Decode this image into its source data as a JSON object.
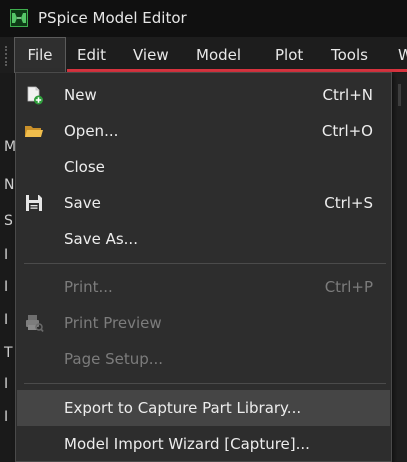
{
  "window": {
    "title": "PSpice Model Editor"
  },
  "menubar": {
    "items": [
      {
        "label": "File"
      },
      {
        "label": "Edit"
      },
      {
        "label": "View"
      },
      {
        "label": "Model"
      },
      {
        "label": "Plot"
      },
      {
        "label": "Tools"
      },
      {
        "label": "W"
      }
    ],
    "active": "File"
  },
  "background": {
    "letters": [
      "M",
      "N",
      "S",
      "I",
      "I",
      "I",
      "T",
      "I",
      "I"
    ]
  },
  "file_menu": {
    "new": {
      "label": "New",
      "shortcut": "Ctrl+N",
      "icon": "new-file-icon"
    },
    "open": {
      "label": "Open...",
      "shortcut": "Ctrl+O",
      "icon": "folder-open-icon"
    },
    "close": {
      "label": "Close"
    },
    "save": {
      "label": "Save",
      "shortcut": "Ctrl+S",
      "icon": "save-icon"
    },
    "save_as": {
      "label": "Save As..."
    },
    "print": {
      "label": "Print...",
      "shortcut": "Ctrl+P",
      "enabled": false
    },
    "print_preview": {
      "label": "Print Preview",
      "enabled": false,
      "icon": "print-preview-icon"
    },
    "page_setup": {
      "label": "Page Setup...",
      "enabled": false
    },
    "export": {
      "label": "Export to Capture Part Library...",
      "highlighted": true
    },
    "import_wizard": {
      "label": "Model Import Wizard [Capture]..."
    }
  },
  "colors": {
    "accent_underline": "#d8343f",
    "menu_background": "#2d2d2d",
    "highlight": "#454545",
    "disabled_text": "#7c7c7c"
  }
}
